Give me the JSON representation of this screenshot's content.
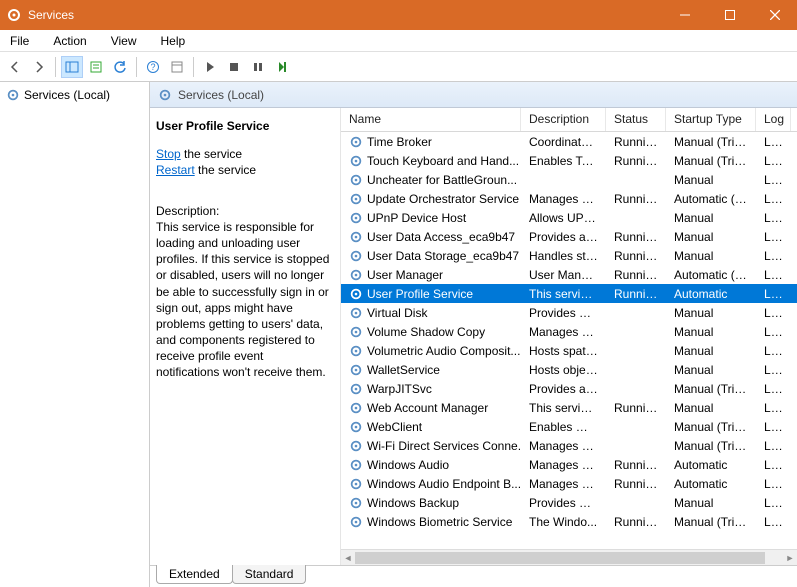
{
  "window": {
    "title": "Services"
  },
  "menubar": [
    "File",
    "Action",
    "View",
    "Help"
  ],
  "tree": {
    "root": "Services (Local)"
  },
  "header_strip": {
    "title": "Services (Local)"
  },
  "detail": {
    "title": "User Profile Service",
    "stop_text": "Stop",
    "stop_suffix": " the service",
    "restart_text": "Restart",
    "restart_suffix": " the service",
    "desc_label": "Description:",
    "desc_body": "This service is responsible for loading and unloading user profiles. If this service is stopped or disabled, users will no longer be able to successfully sign in or sign out, apps might have problems getting to users' data, and components registered to receive profile event notifications won't receive them."
  },
  "columns": {
    "name": "Name",
    "desc": "Description",
    "status": "Status",
    "startup": "Startup Type",
    "logon": "Log"
  },
  "services": [
    {
      "name": "Time Broker",
      "desc": "Coordinates...",
      "status": "Running",
      "startup": "Manual (Trig...",
      "logon": "Loc"
    },
    {
      "name": "Touch Keyboard and Hand...",
      "desc": "Enables Tou...",
      "status": "Running",
      "startup": "Manual (Trig...",
      "logon": "Loc"
    },
    {
      "name": "Uncheater for BattleGroun...",
      "desc": "",
      "status": "",
      "startup": "Manual",
      "logon": "Loc"
    },
    {
      "name": "Update Orchestrator Service",
      "desc": "Manages W...",
      "status": "Running",
      "startup": "Automatic (D...",
      "logon": "Loc"
    },
    {
      "name": "UPnP Device Host",
      "desc": "Allows UPn...",
      "status": "",
      "startup": "Manual",
      "logon": "Loc"
    },
    {
      "name": "User Data Access_eca9b47",
      "desc": "Provides ap...",
      "status": "Running",
      "startup": "Manual",
      "logon": "Loc"
    },
    {
      "name": "User Data Storage_eca9b47",
      "desc": "Handles sto...",
      "status": "Running",
      "startup": "Manual",
      "logon": "Loc"
    },
    {
      "name": "User Manager",
      "desc": "User Manag...",
      "status": "Running",
      "startup": "Automatic (T...",
      "logon": "Loc"
    },
    {
      "name": "User Profile Service",
      "desc": "This service ...",
      "status": "Running",
      "startup": "Automatic",
      "logon": "Loc",
      "selected": true
    },
    {
      "name": "Virtual Disk",
      "desc": "Provides m...",
      "status": "",
      "startup": "Manual",
      "logon": "Loc"
    },
    {
      "name": "Volume Shadow Copy",
      "desc": "Manages an...",
      "status": "",
      "startup": "Manual",
      "logon": "Loc"
    },
    {
      "name": "Volumetric Audio Composit...",
      "desc": "Hosts spatia...",
      "status": "",
      "startup": "Manual",
      "logon": "Loc"
    },
    {
      "name": "WalletService",
      "desc": "Hosts objec...",
      "status": "",
      "startup": "Manual",
      "logon": "Loc"
    },
    {
      "name": "WarpJITSvc",
      "desc": "Provides a JI...",
      "status": "",
      "startup": "Manual (Trig...",
      "logon": "Loc"
    },
    {
      "name": "Web Account Manager",
      "desc": "This service ...",
      "status": "Running",
      "startup": "Manual",
      "logon": "Loc"
    },
    {
      "name": "WebClient",
      "desc": "Enables Win...",
      "status": "",
      "startup": "Manual (Trig...",
      "logon": "Loc"
    },
    {
      "name": "Wi-Fi Direct Services Conne...",
      "desc": "Manages co...",
      "status": "",
      "startup": "Manual (Trig...",
      "logon": "Loc"
    },
    {
      "name": "Windows Audio",
      "desc": "Manages au...",
      "status": "Running",
      "startup": "Automatic",
      "logon": "Loc"
    },
    {
      "name": "Windows Audio Endpoint B...",
      "desc": "Manages au...",
      "status": "Running",
      "startup": "Automatic",
      "logon": "Loc"
    },
    {
      "name": "Windows Backup",
      "desc": "Provides Wi...",
      "status": "",
      "startup": "Manual",
      "logon": "Loc"
    },
    {
      "name": "Windows Biometric Service",
      "desc": "The Windo...",
      "status": "Running",
      "startup": "Manual (Trig...",
      "logon": "Loc"
    }
  ],
  "tabs": {
    "extended": "Extended",
    "standard": "Standard"
  }
}
